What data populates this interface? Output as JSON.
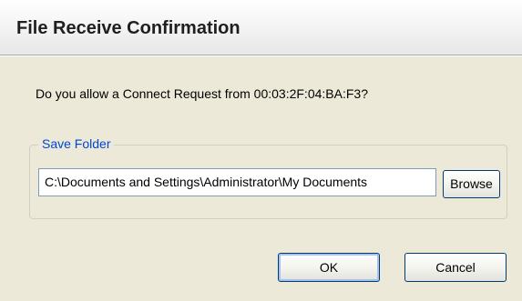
{
  "window": {
    "title": "File Receive Confirmation"
  },
  "prompt": {
    "text": "Do you allow a Connect Request from 00:03:2F:04:BA:F3?"
  },
  "save_folder": {
    "group_label": "Save Folder",
    "path_value": "C:\\Documents and Settings\\Administrator\\My Documents",
    "browse_label": "Browse"
  },
  "actions": {
    "ok_label": "OK",
    "cancel_label": "Cancel"
  },
  "colors": {
    "background": "#ece9d8",
    "group_label": "#0046d5",
    "button_border": "#003c74"
  }
}
